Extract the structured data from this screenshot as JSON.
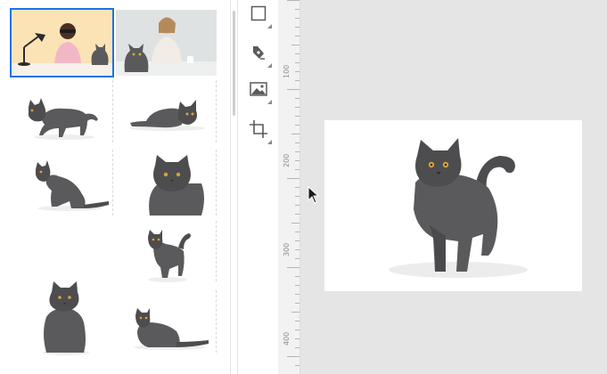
{
  "image_panel": {
    "thumbnails": [
      {
        "name": "photo-person-lamp-cat",
        "kind": "photo",
        "bg": "#fbe3b6"
      },
      {
        "name": "photo-woman-cat",
        "kind": "photo",
        "bg": "#dfe2e3"
      },
      {
        "name": "cat-walking-left",
        "kind": "cutout"
      },
      {
        "name": "cat-lying",
        "kind": "cutout"
      },
      {
        "name": "cat-sitting-side",
        "kind": "cutout"
      },
      {
        "name": "cat-face-front",
        "kind": "cutout"
      },
      {
        "name": "cat-standing-tail-up",
        "kind": "cutout"
      },
      {
        "name": "cat-sitting-front",
        "kind": "cutout"
      },
      {
        "name": "cat-crouching",
        "kind": "cutout"
      }
    ]
  },
  "tools": [
    {
      "name": "rectangle-tool",
      "icon": "square-icon"
    },
    {
      "name": "pen-tool",
      "icon": "pen-nib-icon"
    },
    {
      "name": "image-tool",
      "icon": "image-icon"
    },
    {
      "name": "crop-tool",
      "icon": "crop-icon"
    }
  ],
  "ruler": {
    "labels": [
      "100",
      "200",
      "300",
      "400"
    ]
  },
  "canvas": {
    "background": "#e5e5e5",
    "artboard_color": "#ffffff",
    "content": "cat-standing-tail-up"
  },
  "colors": {
    "cat": "#5a5a5c",
    "cat_dark": "#3f3f41",
    "eye": "#d9a23a",
    "selection": "#1a73e8"
  }
}
